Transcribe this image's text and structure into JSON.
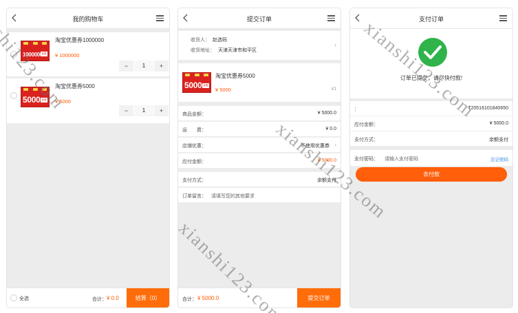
{
  "cart": {
    "title": "我的购物车",
    "items": [
      {
        "name": "淘宝优惠券1000000",
        "price": "¥ 1000000",
        "qty": "1",
        "coupon_amount": "1000000"
      },
      {
        "name": "淘宝优惠券5000",
        "price": "¥ 5000",
        "qty": "1",
        "coupon_amount": "5000"
      }
    ],
    "select_all": "全选",
    "total_label": "合计：",
    "total_value": "¥ 0.0",
    "checkout_label": "结算（0）",
    "minus": "−",
    "plus": "+"
  },
  "submit": {
    "title": "提交订单",
    "recipient_label": "收货人：",
    "recipient_value": "赵选码",
    "address_label": "收货地址：",
    "address_value": "天津天津市和平区",
    "product": {
      "name": "淘宝优惠券5000",
      "price": "¥ 5000",
      "qty": "x1",
      "coupon_amount": "5000"
    },
    "rows": [
      {
        "label": "商品金额：",
        "value": "¥ 5000.0"
      },
      {
        "label": "运　　费：",
        "value": "¥ 0.0"
      },
      {
        "label": "店铺优惠：",
        "value": "不使用优惠券"
      },
      {
        "label": "应付金额：",
        "value": "¥ 5000.0"
      }
    ],
    "payment_label": "支付方式：",
    "payment_value": "余额支付",
    "note_label": "订单留言：",
    "note_placeholder": "请填写您的其他要求",
    "total_label": "合计：",
    "total_value": "¥ 5000.0",
    "submit_button": "提交订单"
  },
  "pay": {
    "title": "支付订单",
    "success_message": "订单已提交，请尽快付款!",
    "order_no_label": "：",
    "order_no_value": "T20516101840650",
    "amount_label": "应付金额：",
    "amount_value": "¥ 5000.0",
    "method_label": "支付方式：",
    "method_value": "余额支付",
    "password_label": "支付密码：",
    "password_placeholder": "请输入支付密码",
    "forgot_password": "忘记密码",
    "pay_button": "去付款"
  },
  "watermark_text": "xianshi123.com",
  "colors": {
    "accent": "#ff6d0a",
    "price": "#ff5a00",
    "success": "#2fb34a",
    "coupon_red": "#d9221f"
  }
}
